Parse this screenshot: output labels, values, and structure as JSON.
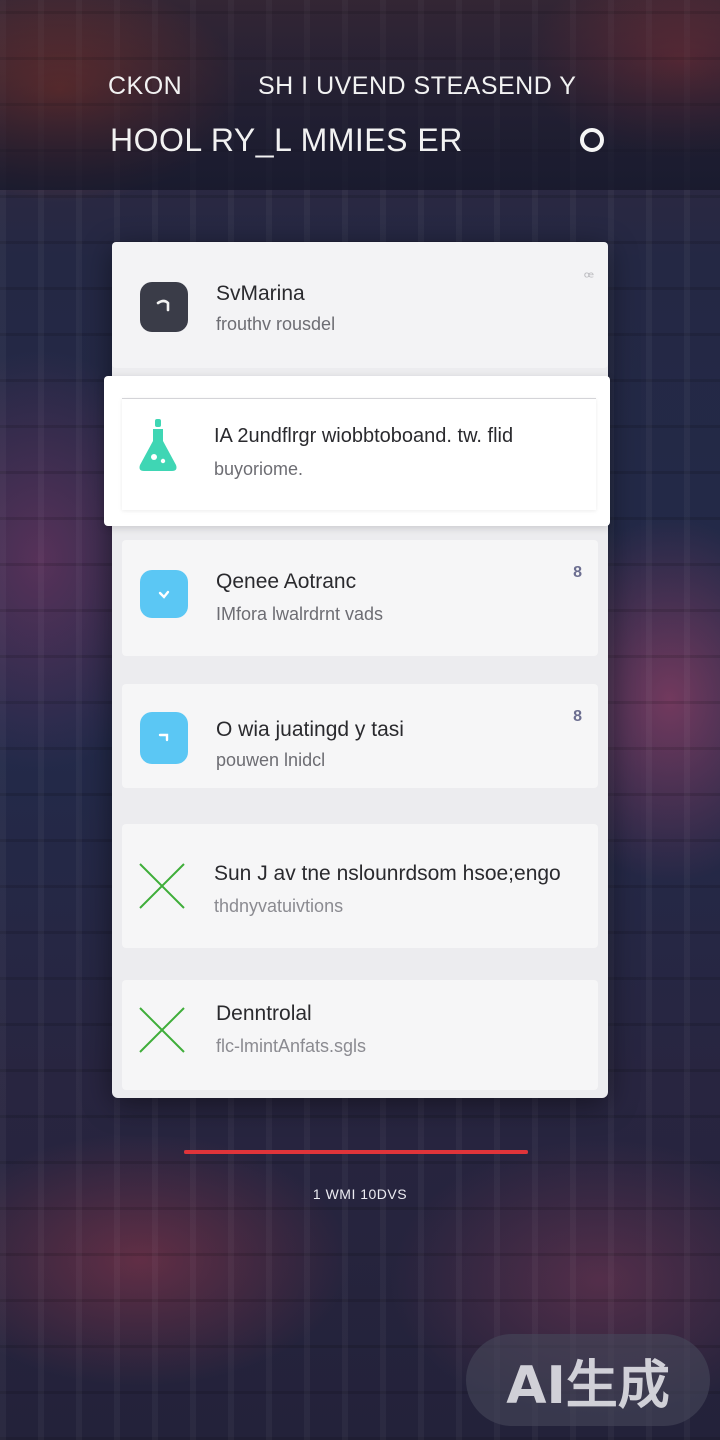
{
  "header": {
    "line1_left": "CKON",
    "line1_right": "SH  I UVEND  STEASEND  Y",
    "line2": "HOOL  RY_L  MMIES ER"
  },
  "notifications": [
    {
      "title": "SvMarina",
      "subtitle": "frouthv rousdel",
      "icon": "dark-rounded-icon",
      "corner": "ꟹ"
    },
    {
      "title": "IA 2undflrgr wiobbtoboand. tw. flid",
      "subtitle": "buyoriome.",
      "icon": "flask-icon",
      "icon_color": "#3fd6b4"
    },
    {
      "title": "Qenee  Aotranc",
      "subtitle": "IMfora lwalrdrnt vads",
      "icon": "blue-check-icon",
      "icon_color": "#5bc7f4",
      "corner": "8"
    },
    {
      "title": "O wia juatingd y tasi",
      "subtitle": "pouwen lnidcl",
      "icon": "blue-arrow-icon",
      "icon_color": "#5bc7f4",
      "corner": "8"
    },
    {
      "title": "Sun J av tne nslounrdsom hsoe;engo",
      "subtitle": "thdnyvatuivtions",
      "icon": "green-cross-icon",
      "icon_color": "#3fae3a"
    },
    {
      "title": "Denntrolal",
      "subtitle": "flc-lmintAnfats.sgls",
      "icon": "green-cross-icon",
      "icon_color": "#3fae3a"
    }
  ],
  "progress": {
    "value": 1.0,
    "color": "#e0343a"
  },
  "footer": {
    "text": "1 WMI 10DVS"
  },
  "watermark": {
    "text": "AI生成"
  }
}
